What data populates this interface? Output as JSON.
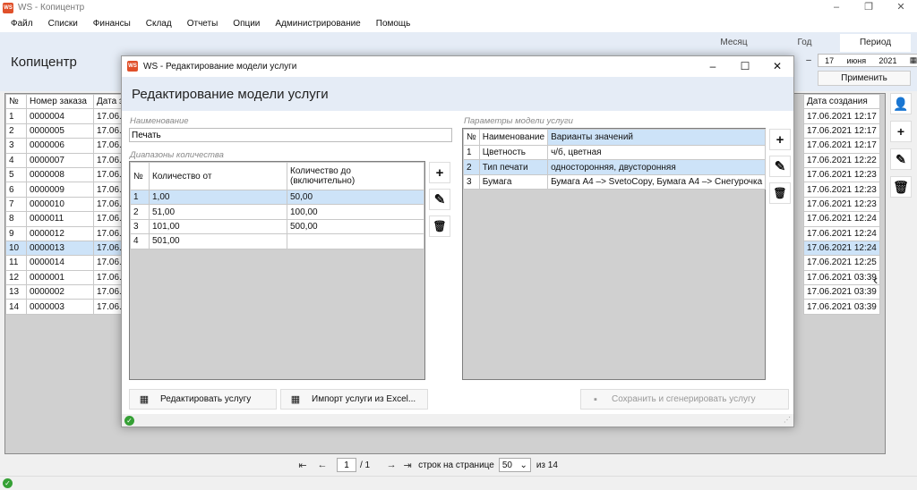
{
  "window": {
    "title": "WS - Копицентр",
    "minimize": "–",
    "maximize": "❐",
    "close": "✕"
  },
  "menu": [
    "Файл",
    "Списки",
    "Финансы",
    "Склад",
    "Отчеты",
    "Опции",
    "Администрирование",
    "Помощь"
  ],
  "app_heading": "Копицентр",
  "period": {
    "tabs": [
      "Месяц",
      "Год",
      "Период"
    ],
    "active_tab": "Период",
    "dash": "–",
    "day": "17",
    "month": "июня",
    "year": "2021",
    "apply": "Применить"
  },
  "main_table": {
    "headers": [
      "№",
      "Номер заказа",
      "Дата за"
    ],
    "rows": [
      [
        "1",
        "0000004",
        "17.06.2"
      ],
      [
        "2",
        "0000005",
        "17.06.2"
      ],
      [
        "3",
        "0000006",
        "17.06.2"
      ],
      [
        "4",
        "0000007",
        "17.06.2"
      ],
      [
        "5",
        "0000008",
        "17.06.2"
      ],
      [
        "6",
        "0000009",
        "17.06.2"
      ],
      [
        "7",
        "0000010",
        "17.06.2"
      ],
      [
        "8",
        "0000011",
        "17.06.2"
      ],
      [
        "9",
        "0000012",
        "17.06.2"
      ],
      [
        "10",
        "0000013",
        "17.06.2"
      ],
      [
        "11",
        "0000014",
        "17.06.2"
      ],
      [
        "12",
        "0000001",
        "17.06.2"
      ],
      [
        "13",
        "0000002",
        "17.06.2"
      ],
      [
        "14",
        "0000003",
        "17.06.2"
      ]
    ],
    "selected_row": 9,
    "created_header": "Дата создания",
    "created": [
      "17.06.2021 12:17",
      "17.06.2021 12:17",
      "17.06.2021 12:17",
      "17.06.2021 12:22",
      "17.06.2021 12:23",
      "17.06.2021 12:23",
      "17.06.2021 12:23",
      "17.06.2021 12:24",
      "17.06.2021 12:24",
      "17.06.2021 12:24",
      "17.06.2021 12:25",
      "17.06.2021 03:39",
      "17.06.2021 03:39",
      "17.06.2021 03:39"
    ]
  },
  "right_tools": {
    "add_user_icon": "person-add-icon",
    "add": "+",
    "edit": "✎",
    "delete": "🗑"
  },
  "collapse": "‹",
  "pager": {
    "first": "⇤",
    "prev": "←",
    "page": "1",
    "of": "/ 1",
    "next": "→",
    "last": "⇥",
    "rows_label": "строк на странице",
    "rows_value": "50",
    "total": "из 14"
  },
  "dialog": {
    "title": "WS - Редактирование модели услуги",
    "heading": "Редактирование модели услуги",
    "name_label": "Наименование",
    "name_value": "Печать",
    "ranges_label": "Диапазоны количества",
    "ranges": {
      "headers": [
        "№",
        "Количество от",
        "Количество до\n(включительно)"
      ],
      "rows": [
        [
          "1",
          "1,00",
          "50,00"
        ],
        [
          "2",
          "51,00",
          "100,00"
        ],
        [
          "3",
          "101,00",
          "500,00"
        ],
        [
          "4",
          "501,00",
          ""
        ]
      ],
      "selected_row": 0
    },
    "params_label": "Параметры модели услуги",
    "params": {
      "headers": [
        "№",
        "Наименование",
        "Варианты значений"
      ],
      "rows": [
        [
          "1",
          "Цветность",
          "ч/б, цветная"
        ],
        [
          "2",
          "Тип печати",
          "односторонняя, двусторонняя"
        ],
        [
          "3",
          "Бумага",
          "Бумага А4 –> SvetoCopy, Бумага А4 –> Снегурочка"
        ]
      ],
      "selected_row": 1
    },
    "buttons": {
      "edit_service": "Редактировать услугу",
      "import_excel": "Импорт услуги из Excel...",
      "save_generate": "Сохранить и сгенерировать услугу"
    },
    "status_ok": "✓"
  },
  "colors": {
    "header_band": "#e5ecf6",
    "selection": "#cde3f8",
    "ok": "#35a035"
  }
}
